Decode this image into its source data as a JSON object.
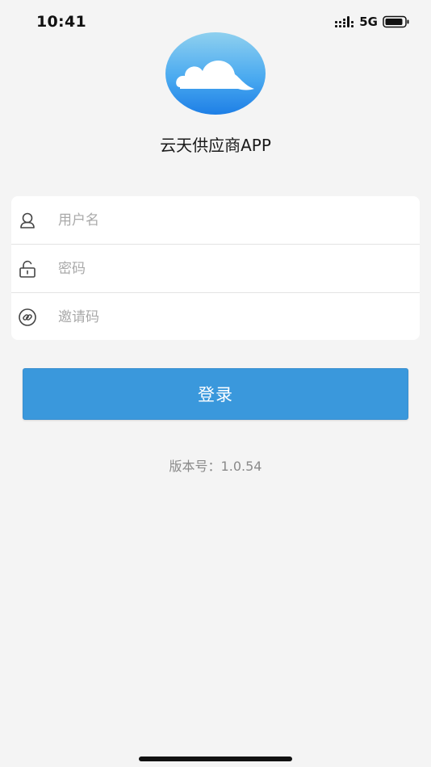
{
  "status_bar": {
    "time": "10:41",
    "network": "5G",
    "icons": [
      "signal-icon",
      "battery-icon"
    ]
  },
  "app": {
    "name": "云天供应商APP",
    "logo_icon": "cloud-icon",
    "brand_color": "#3a98dc"
  },
  "form": {
    "username": {
      "placeholder": "用户名",
      "value": "",
      "icon": "user-icon"
    },
    "password": {
      "placeholder": "密码",
      "value": "",
      "icon": "lock-icon"
    },
    "invite_code": {
      "placeholder": "邀请码",
      "value": "",
      "icon": "link-icon"
    }
  },
  "login_button": {
    "label": "登录"
  },
  "version": {
    "label": "版本号：1.0.54"
  }
}
